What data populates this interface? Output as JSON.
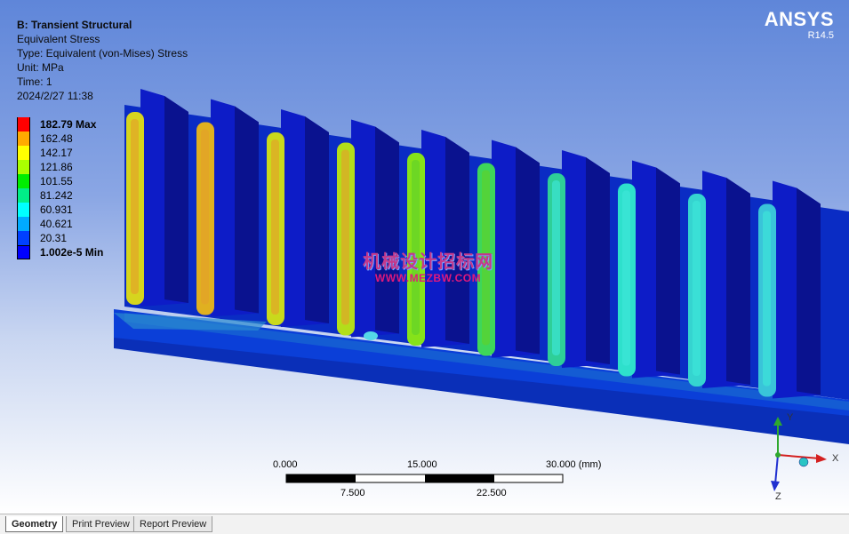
{
  "header": {
    "title": "B: Transient Structural",
    "lines": [
      "Equivalent Stress",
      "Type: Equivalent (von-Mises) Stress",
      "Unit: MPa",
      "Time: 1",
      "2024/2/27 11:38"
    ]
  },
  "legend": {
    "entries": [
      {
        "label": "182.79 Max",
        "color": "#ff0000"
      },
      {
        "label": "162.48",
        "color": "#ffaa00"
      },
      {
        "label": "142.17",
        "color": "#ffff00"
      },
      {
        "label": "121.86",
        "color": "#aaff00"
      },
      {
        "label": "101.55",
        "color": "#00ee00"
      },
      {
        "label": "81.242",
        "color": "#00ee88"
      },
      {
        "label": "60.931",
        "color": "#00ffff"
      },
      {
        "label": "40.621",
        "color": "#00aaff"
      },
      {
        "label": "20.31",
        "color": "#0040ff"
      },
      {
        "label": "1.002e-5 Min",
        "color": "#0000ff"
      }
    ]
  },
  "brand": {
    "logo": "ANSYS",
    "version": "R14.5"
  },
  "scale_bar": {
    "top_labels": [
      "0.000",
      "15.000",
      "30.000 (mm)"
    ],
    "bottom_labels": [
      "7.500",
      "22.500"
    ]
  },
  "watermark": {
    "chinese": "机械设计招标网",
    "url": "WWW.MEZBW.COM"
  },
  "triad": {
    "x": "X",
    "y": "Y",
    "z": "Z"
  },
  "tabs": [
    {
      "label": "Geometry",
      "active": true
    },
    {
      "label": "Print Preview",
      "active": false
    },
    {
      "label": "Report Preview",
      "active": false
    }
  ],
  "model": {
    "tooth_stress_colors": [
      "#d6d51e",
      "#e0b020",
      "#c9d91c",
      "#b3de1a",
      "#86e21a",
      "#3ed65a",
      "#2ecf98",
      "#2ee0cc",
      "#35d4d0",
      "#39c4d9"
    ]
  }
}
